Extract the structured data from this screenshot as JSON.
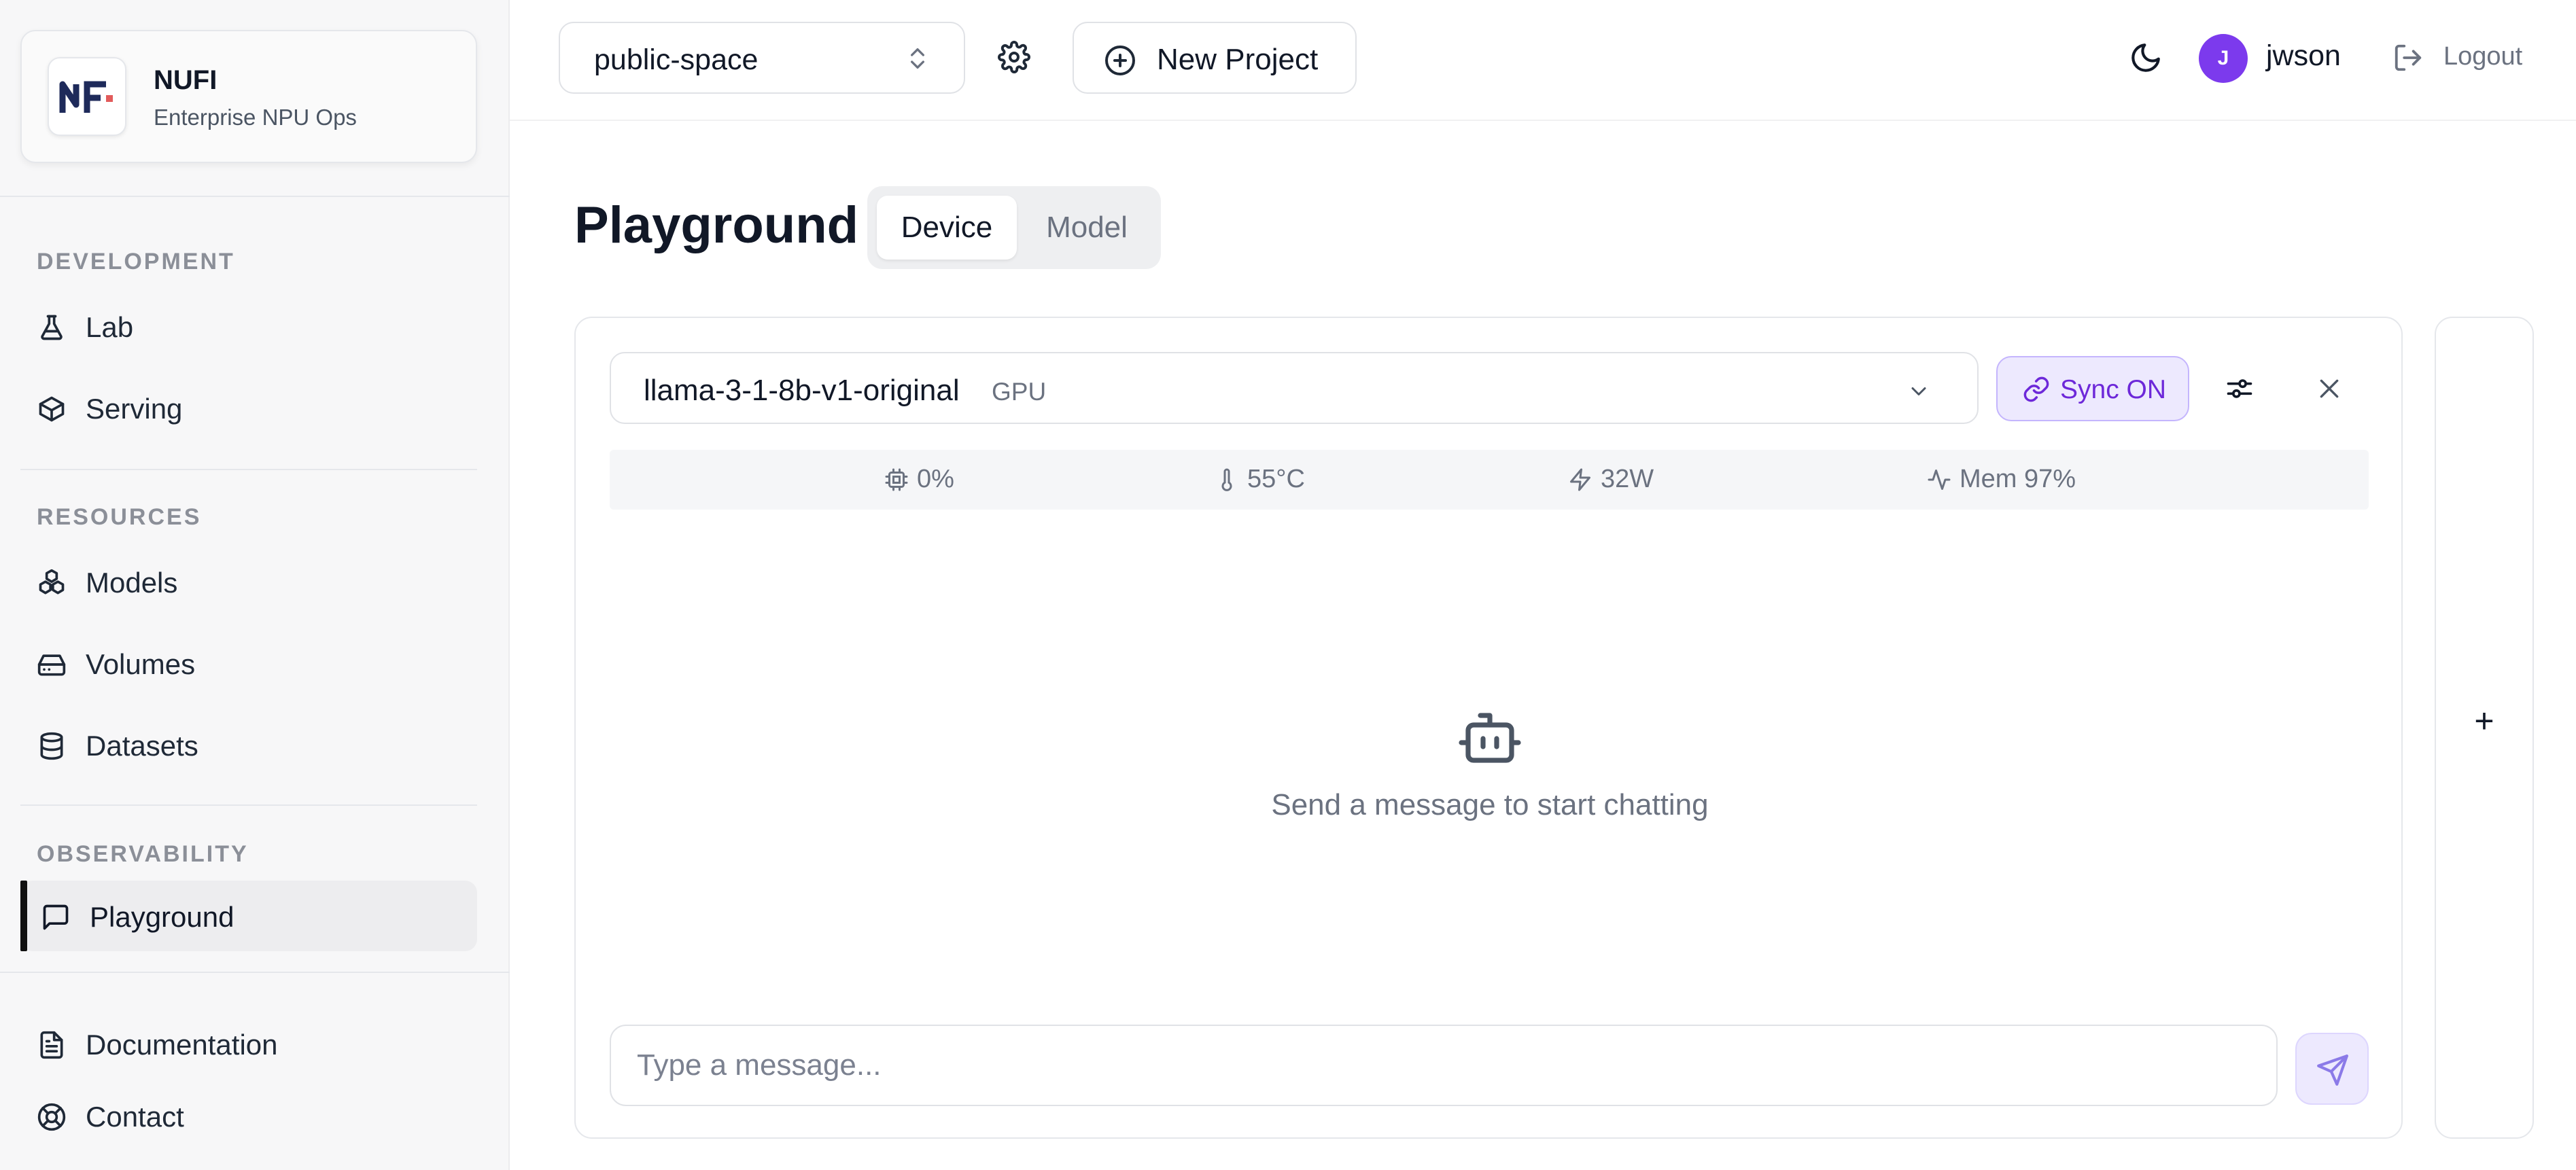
{
  "brand": {
    "logo_text": "NF",
    "name": "NUFI",
    "subtitle": "Enterprise NPU Ops"
  },
  "sidebar": {
    "sections": [
      {
        "title": "DEVELOPMENT",
        "items": [
          {
            "label": "Lab",
            "icon": "flask-icon"
          },
          {
            "label": "Serving",
            "icon": "box-icon"
          }
        ]
      },
      {
        "title": "RESOURCES",
        "items": [
          {
            "label": "Models",
            "icon": "boxes-icon"
          },
          {
            "label": "Volumes",
            "icon": "hard-drive-icon"
          },
          {
            "label": "Datasets",
            "icon": "database-icon"
          }
        ]
      },
      {
        "title": "OBSERVABILITY",
        "items": [
          {
            "label": "Playground",
            "icon": "message-square-icon",
            "active": true
          }
        ]
      }
    ],
    "footer": [
      {
        "label": "Documentation",
        "icon": "file-text-icon"
      },
      {
        "label": "Contact",
        "icon": "life-buoy-icon"
      }
    ]
  },
  "header": {
    "project": "public-space",
    "new_project_label": "New Project",
    "user_initial": "J",
    "username": "jwson",
    "logout_label": "Logout"
  },
  "main": {
    "title": "Playground",
    "tabs": [
      {
        "label": "Device",
        "selected": true
      },
      {
        "label": "Model",
        "selected": false
      }
    ]
  },
  "chat": {
    "model_name": "llama-3-1-8b-v1-original",
    "model_tag": "GPU",
    "sync_label": "Sync ON",
    "stats": [
      {
        "icon": "cpu-icon",
        "value": "0%"
      },
      {
        "icon": "thermometer-icon",
        "value": "55°C"
      },
      {
        "icon": "zap-icon",
        "value": "32W"
      },
      {
        "icon": "activity-icon",
        "value": "Mem 97%"
      }
    ],
    "empty_message": "Send a message to start chatting",
    "input_placeholder": "Type a message...",
    "input_value": ""
  },
  "add_panel": {
    "label": "+"
  },
  "colors": {
    "accent": "#7c3aed",
    "accent_soft": "#ede9fe",
    "active_bar": "#111111",
    "muted_text": "#6b7280"
  }
}
